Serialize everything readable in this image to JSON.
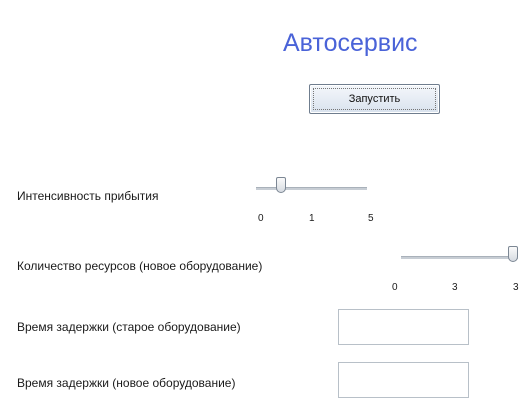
{
  "app": {
    "title": "Автосервис"
  },
  "toolbar": {
    "run_label": "Запустить"
  },
  "arrival": {
    "label": "Интенсивность прибытия",
    "slider": {
      "min": 0,
      "max": 5,
      "value": 1
    },
    "ticks": {
      "min": "0",
      "current": "1",
      "max": "5"
    }
  },
  "resources": {
    "label": "Количество ресурсов (новое оборудование)",
    "slider": {
      "min": 0,
      "max": 3,
      "value": 3
    },
    "ticks": {
      "min": "0",
      "current": "3",
      "max": "3"
    }
  },
  "delay_old": {
    "label": "Время задержки (старое оборудование)",
    "value": ""
  },
  "delay_new": {
    "label": "Время задержки (новое оборудование)",
    "value": ""
  }
}
